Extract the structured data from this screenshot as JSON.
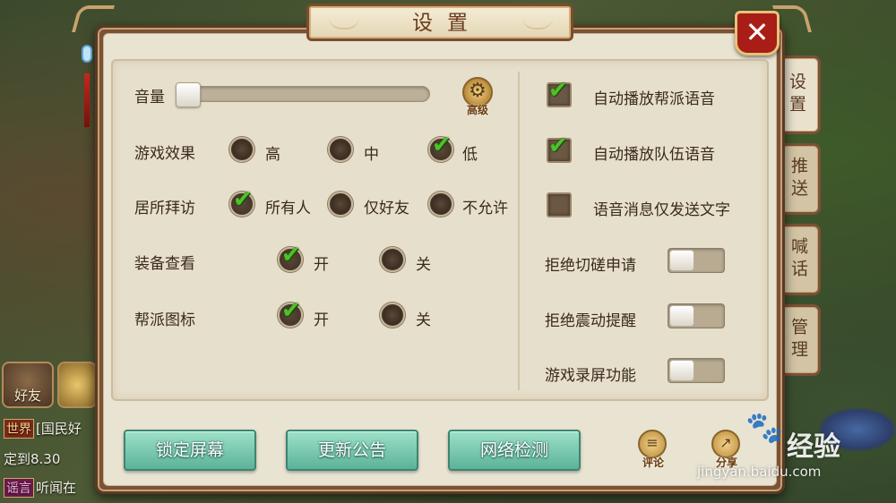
{
  "panel": {
    "title": "设置",
    "close_label": "✕"
  },
  "side_tabs": [
    {
      "label": "设置",
      "active": true
    },
    {
      "label": "推送",
      "active": false
    },
    {
      "label": "喊话",
      "active": false
    },
    {
      "label": "管理",
      "active": false
    }
  ],
  "volume": {
    "label": "音量",
    "level_fraction": 0.0
  },
  "advanced": {
    "label": "高级"
  },
  "game_effect": {
    "label": "游戏效果",
    "options": [
      {
        "label": "高",
        "selected": false
      },
      {
        "label": "中",
        "selected": false
      },
      {
        "label": "低",
        "selected": true
      }
    ]
  },
  "residence_visit": {
    "label": "居所拜访",
    "options": [
      {
        "label": "所有人",
        "selected": true
      },
      {
        "label": "仅好友",
        "selected": false
      },
      {
        "label": "不允许",
        "selected": false
      }
    ]
  },
  "equip_view": {
    "label": "装备查看",
    "options": [
      {
        "label": "开",
        "selected": true
      },
      {
        "label": "关",
        "selected": false
      }
    ]
  },
  "guild_icon": {
    "label": "帮派图标",
    "options": [
      {
        "label": "开",
        "selected": true
      },
      {
        "label": "关",
        "selected": false
      }
    ]
  },
  "checkboxes": [
    {
      "label": "自动播放帮派语音",
      "checked": true
    },
    {
      "label": "自动播放队伍语音",
      "checked": true
    },
    {
      "label": "语音消息仅发送文字",
      "checked": false
    }
  ],
  "toggles": [
    {
      "label": "拒绝切磋申请",
      "on": false
    },
    {
      "label": "拒绝震动提醒",
      "on": false
    },
    {
      "label": "游戏录屏功能",
      "on": false
    }
  ],
  "bottom_buttons": {
    "lock_screen": "锁定屏幕",
    "update_notice": "更新公告",
    "network_check": "网络检测"
  },
  "round_buttons": {
    "comment": "评论",
    "share": "分享"
  },
  "background_ui": {
    "friends_label": "好友",
    "chat": [
      {
        "tag": "世界",
        "text": "[国民好"
      },
      {
        "tag": "",
        "text": "定到8.30"
      },
      {
        "tag": "谣言",
        "text": "听闻在"
      }
    ]
  },
  "watermark": {
    "brand": "经验",
    "url": "jingyan.baidu.com"
  },
  "colors": {
    "panel_frame": "#7a5238",
    "panel_bg": "#e9e3d2",
    "check_green": "#4dc22a",
    "button_green": "#5cb29a",
    "close_red": "#a81d16"
  }
}
